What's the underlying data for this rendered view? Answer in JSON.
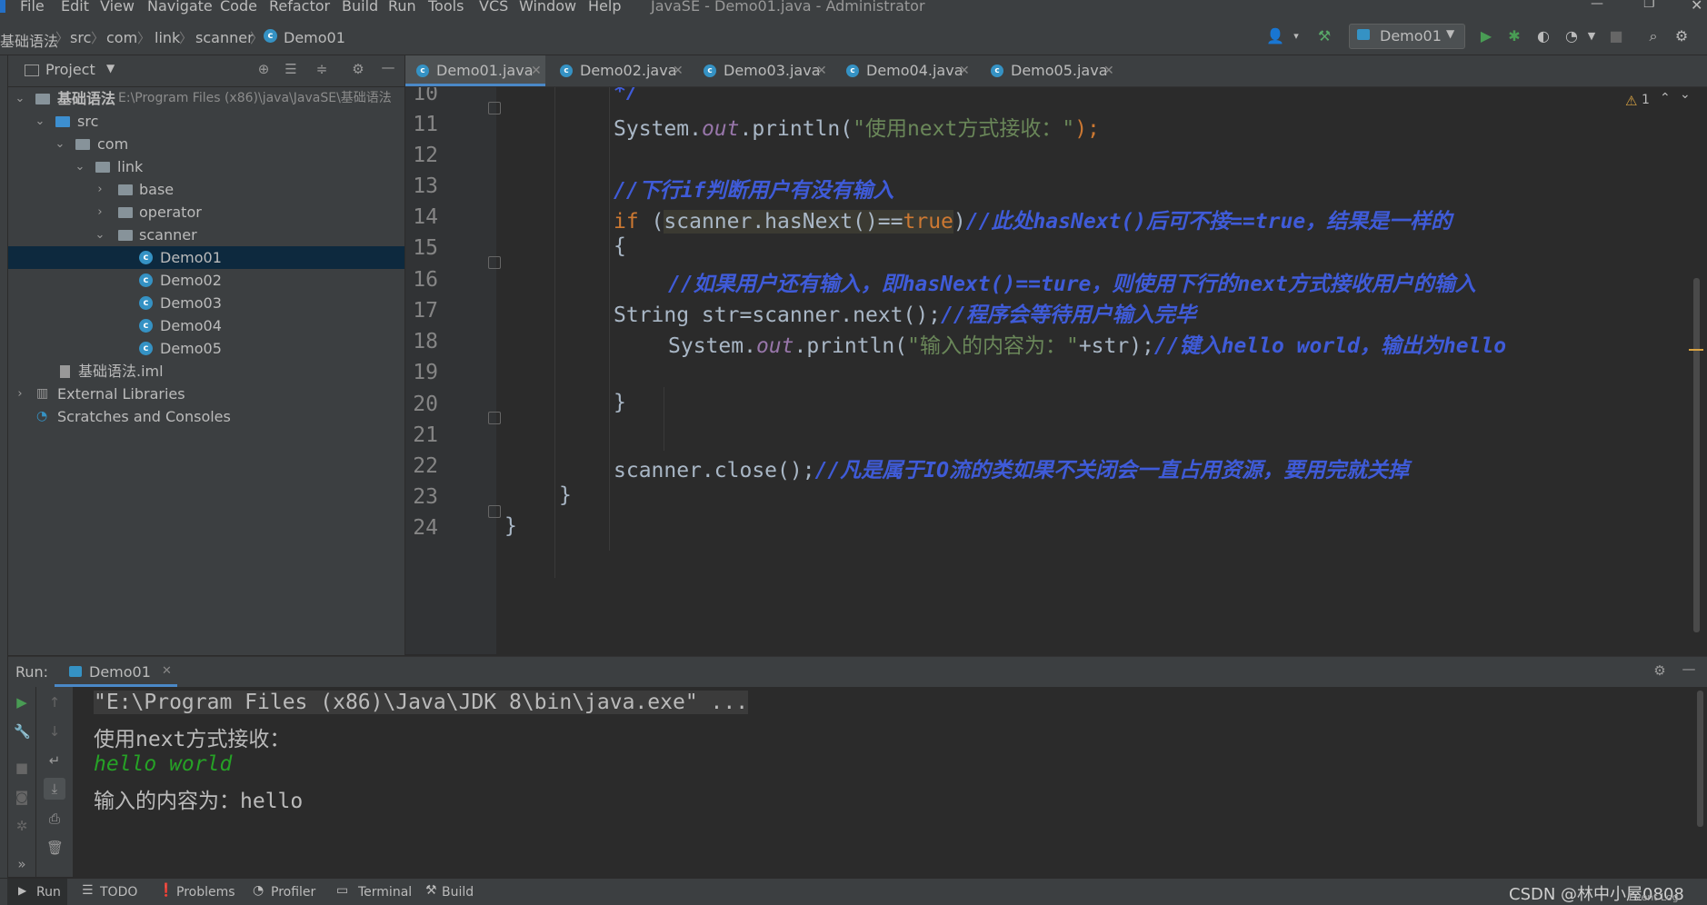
{
  "menu": [
    "File",
    "Edit",
    "View",
    "Navigate",
    "Code",
    "Refactor",
    "Build",
    "Run",
    "Tools",
    "VCS",
    "Window",
    "Help"
  ],
  "window_title": "JavaSE - Demo01.java - Administrator",
  "breadcrumb": [
    "基础语法",
    "src",
    "com",
    "link",
    "scanner",
    "Demo01"
  ],
  "run_config": "Demo01",
  "project": {
    "header": "Project",
    "root_name": "基础语法",
    "root_path": "E:\\Program Files (x86)\\java\\JavaSE\\基础语法",
    "items": [
      "src",
      "com",
      "link",
      "base",
      "operator",
      "scanner",
      "Demo01",
      "Demo02",
      "Demo03",
      "Demo04",
      "Demo05",
      "基础语法.iml",
      "External Libraries",
      "Scratches and Consoles"
    ]
  },
  "tabs": [
    "Demo01.java",
    "Demo02.java",
    "Demo03.java",
    "Demo04.java",
    "Demo05.java"
  ],
  "warnings": "1",
  "lines": [
    "10",
    "11",
    "12",
    "13",
    "14",
    "15",
    "16",
    "17",
    "18",
    "19",
    "20",
    "21",
    "22",
    "23",
    "24"
  ],
  "code": {
    "l10": "*/",
    "l11_a": "System.",
    "l11_b": "out",
    "l11_c": ".println(",
    "l11_d": "\"使用next方式接收：\"",
    "l11_e": ");",
    "l13": "//下行if判断用户有没有输入",
    "l14_a": "if",
    "l14_b": " (",
    "l14_c": "scanner.hasNext()==",
    "l14_d": "true",
    "l14_e": ")",
    "l14_f": "//此处hasNext()后可不接==true，结果是一样的",
    "l15": "{",
    "l16": "//如果用户还有输入，即hasNext()==ture，则使用下行的next方式接收用户的输入",
    "l17_a": "String str=scanner.next();",
    "l17_b": "//程序会等待用户输入完毕",
    "l18_a": "System.",
    "l18_b": "out",
    "l18_c": ".println(",
    "l18_d": "\"输入的内容为：\"",
    "l18_e": "+str);",
    "l18_f": "//键入hello world，输出为hello",
    "l20": "}",
    "l22_a": "scanner.close();",
    "l22_b": "//凡是属于IO流的类如果不关闭会一直占用资源，要用完就关掉",
    "l23": "}",
    "l24": "}"
  },
  "run": {
    "label": "Run:",
    "tab": "Demo01",
    "console": [
      "\"E:\\Program Files (x86)\\Java\\JDK 8\\bin\\java.exe\" ...",
      "使用next方式接收：",
      "hello world",
      "输入的内容为：hello"
    ]
  },
  "statusbar": {
    "items": [
      "Run",
      "TODO",
      "Problems",
      "Profiler",
      "Terminal",
      "Build"
    ],
    "watermark": "CSDN @林中小屋0808",
    "event_log": "Event Log"
  },
  "colors": {
    "keyword": "#cc7832",
    "string": "#6a8759",
    "comment": "#3f5bd8",
    "field": "#9876aa",
    "accent": "#4a88c7"
  }
}
